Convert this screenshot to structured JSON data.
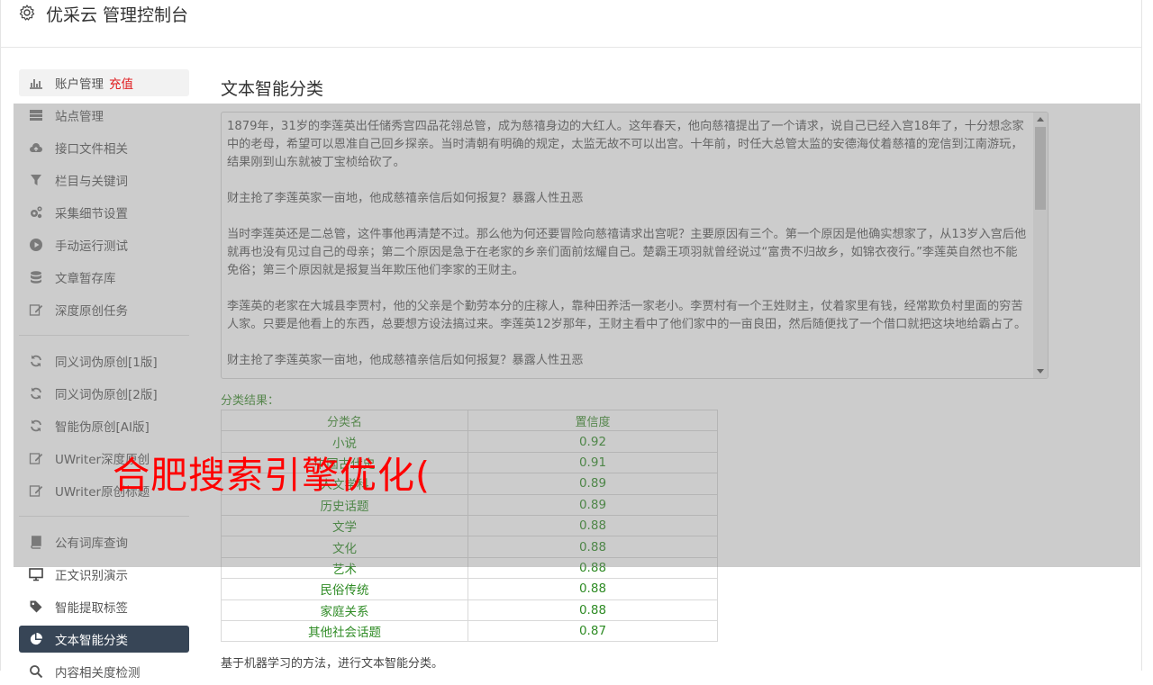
{
  "header": {
    "title": "优采云 管理控制台",
    "icon": "gear-icon"
  },
  "sidebar": {
    "items": [
      {
        "label": "账户管理",
        "badge": "充值",
        "icon": "bar-chart-icon"
      },
      {
        "label": "站点管理",
        "icon": "server-icon"
      },
      {
        "label": "接口文件相关",
        "icon": "cloud-upload-icon"
      },
      {
        "label": "栏目与关键词",
        "icon": "filter-icon"
      },
      {
        "label": "采集细节设置",
        "icon": "gears-icon"
      },
      {
        "label": "手动运行测试",
        "icon": "play-circle-icon"
      },
      {
        "label": "文章暂存库",
        "icon": "database-icon"
      },
      {
        "label": "深度原创任务",
        "icon": "edit-icon"
      },
      {
        "label": "同义词伪原创[1版]",
        "icon": "refresh-icon"
      },
      {
        "label": "同义词伪原创[2版]",
        "icon": "refresh-icon"
      },
      {
        "label": "智能伪原创[AI版]",
        "icon": "refresh-icon"
      },
      {
        "label": "UWriter深度原创",
        "icon": "edit-icon"
      },
      {
        "label": "UWriter原创标题",
        "icon": "edit-icon"
      },
      {
        "label": "公有词库查询",
        "icon": "book-icon"
      },
      {
        "label": "正文识别演示",
        "icon": "monitor-icon"
      },
      {
        "label": "智能提取标签",
        "icon": "tag-icon"
      },
      {
        "label": "文本智能分类",
        "icon": "pie-chart-icon"
      },
      {
        "label": "内容相关度检测",
        "icon": "search-icon"
      }
    ]
  },
  "main": {
    "title": "文本智能分类",
    "paragraphs": [
      "1879年，31岁的李莲英出任储秀宫四品花翎总管，成为慈禧身边的大红人。这年春天，他向慈禧提出了一个请求，说自己已经入宫18年了，十分想念家中的老母，希望可以恩准自己回乡探亲。当时清朝有明确的规定，太监无故不可以出宫。十年前，时任大总管太监的安德海仗着慈禧的宠信到江南游玩，结果刚到山东就被丁宝桢给砍了。",
      "财主抢了李莲英家一亩地，他成慈禧亲信后如何报复？暴露人性丑恶",
      "当时李莲英还是二总管，这件事他再清楚不过。那么他为何还要冒险向慈禧请求出宫呢？主要原因有三个。第一个原因是他确实想家了，从13岁入宫后他就再也没有见过自己的母亲；第二个原因是急于在老家的乡亲们面前炫耀自己。楚霸王项羽就曾经说过“富贵不归故乡，如锦衣夜行。”李莲英自然也不能免俗；第三个原因就是报复当年欺压他们李家的王财主。",
      "李莲英的老家在大城县李贾村，他的父亲是个勤劳本分的庄稼人，靠种田养活一家老小。李贾村有一个王姓财主，仗着家里有钱，经常欺负村里面的穷苦人家。只要是他看上的东西，总要想方设法搞过来。李莲英12岁那年，王财主看中了他们家中的一亩良田，然后随便找了一个借口就把这块地给霸占了。",
      "财主抢了李莲英家一亩地，他成慈禧亲信后如何报复？暴露人性丑恶"
    ],
    "result_label": "分类结果：",
    "table": {
      "headers": [
        "分类名",
        "置信度"
      ],
      "rows": [
        [
          "小说",
          "0.92"
        ],
        [
          "中国古代史",
          "0.91"
        ],
        [
          "人文学科",
          "0.89"
        ],
        [
          "历史话题",
          "0.89"
        ],
        [
          "文学",
          "0.88"
        ],
        [
          "文化",
          "0.88"
        ],
        [
          "艺术",
          "0.88"
        ],
        [
          "民俗传统",
          "0.88"
        ],
        [
          "家庭关系",
          "0.88"
        ],
        [
          "其他社会话题",
          "0.87"
        ]
      ]
    },
    "footer_note": "基于机器学习的方法，进行文本智能分类。"
  },
  "watermark": "合肥搜索引擎优化(",
  "colors": {
    "active_bg": "#374556",
    "recharge": "#e0191c",
    "table_text": "#2e8b24",
    "watermark": "#ff0000"
  }
}
